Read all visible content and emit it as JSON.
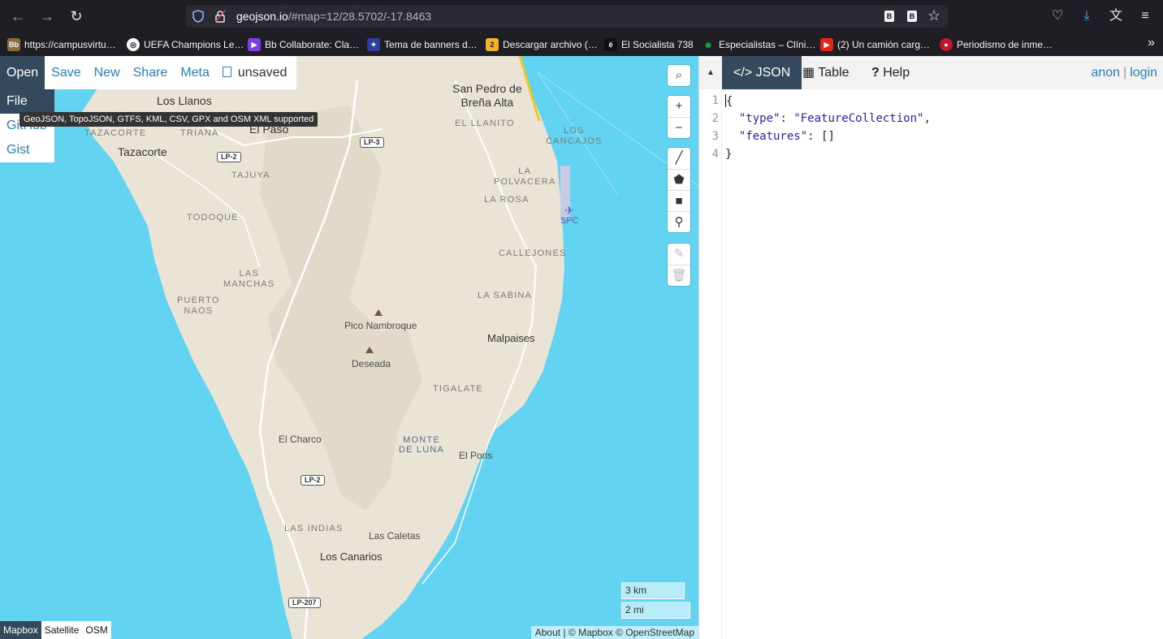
{
  "browser": {
    "url_host": "geojson.io",
    "url_path": "/#map=12/28.5702/-17.8463"
  },
  "bookmarks": [
    {
      "label": "https://campusvirtu…",
      "icon": "bb-icon",
      "color": "#8a6d3b"
    },
    {
      "label": "UEFA Champions Le…",
      "icon": "uefa-icon",
      "color": "#ffffff"
    },
    {
      "label": "Bb Collaborate: Cla…",
      "icon": "collaborate-icon",
      "color": "#7b3fe4"
    },
    {
      "label": "Tema de banners d…",
      "icon": "banner-icon",
      "color": "#2b3f9e"
    },
    {
      "label": "Descargar archivo (…",
      "icon": "download-file-icon",
      "color": "#f0b429"
    },
    {
      "label": "El Socialista 738",
      "icon": "socialista-icon",
      "color": "#111111"
    },
    {
      "label": "Especialistas – Clíni…",
      "icon": "clinic-icon",
      "color": "#1aa34a"
    },
    {
      "label": "(2) Un camión carg…",
      "icon": "youtube-icon",
      "color": "#e62117"
    },
    {
      "label": "Periodismo de inme…",
      "icon": "periodismo-icon",
      "color": "#c0182b"
    }
  ],
  "menu": {
    "open": "Open",
    "save": "Save",
    "new": "New",
    "share": "Share",
    "meta": "Meta",
    "unsaved": "unsaved"
  },
  "open_dropdown": {
    "file": "File",
    "github": "GitHub",
    "gist": "Gist",
    "tooltip": "GeoJSON, TopoJSON, GTFS, KML, CSV, GPX and OSM XML supported"
  },
  "map": {
    "labels": {
      "los_llanos": "Los Llanos",
      "el_paso": "El Paso",
      "tazacorte": "Tazacorte",
      "tazacorte_caps": "TAZACORTE",
      "triana": "TRIANA",
      "tajuya": "TAJUYA",
      "todoque": "TODOQUE",
      "las_manchas": "LAS\nMANCHAS",
      "puerto_naos": "PUERTO\nNAOS",
      "san_pedro": "San Pedro de\nBreña Alta",
      "el_llanito": "EL LLANITO",
      "los_cancajos": "LOS\nCANCAJOS",
      "la_polvacera": "LA\nPOLVACERA",
      "la_rosa": "LA ROSA",
      "spc": "SPC",
      "callejones": "CALLEJONES",
      "la_sabina": "LA SABINA",
      "pico_nambroque": "Pico Nambroque",
      "deseada": "Deseada",
      "malpaises": "Malpaises",
      "tigalate": "TIGALATE",
      "el_charco": "El Charco",
      "monte_de_luna": "MONTE\nDE LUNA",
      "el_poris": "El Poris",
      "las_indias": "LAS INDIAS",
      "las_caletas": "Las Caletas",
      "los_canarios": "Los Canarios"
    },
    "roads": {
      "lp2_a": "LP-2",
      "lp3": "LP-3",
      "lp2_b": "LP-2",
      "lp207": "LP-207"
    },
    "scale_km": "3 km",
    "scale_mi": "2 mi",
    "layers": {
      "mapbox": "Mapbox",
      "satellite": "Satellite",
      "osm": "OSM"
    },
    "attribution": "About | © Mapbox © OpenStreetMap"
  },
  "panel": {
    "tabs": {
      "json": "JSON",
      "table": "Table",
      "help": "Help"
    },
    "user": {
      "anon": "anon",
      "sep": "|",
      "login": "login"
    },
    "line_numbers": [
      "1",
      "2",
      "3",
      "4"
    ],
    "code": {
      "line1": "{",
      "type_key": "\"type\"",
      "type_val": "\"FeatureCollection\"",
      "features_key": "\"features\"",
      "features_val": "[]",
      "line4": "}"
    }
  },
  "colors": {
    "accent": "#2a7fb8",
    "dark": "#34495e",
    "water": "#62d3f0",
    "land": "#e9e4d6"
  }
}
